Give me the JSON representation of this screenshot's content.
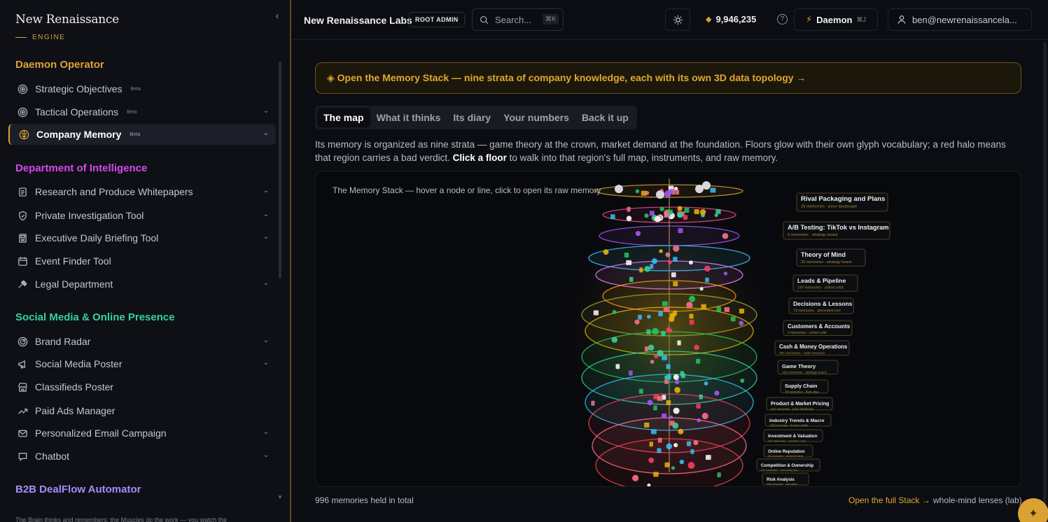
{
  "brand": {
    "name": "New Renaissance",
    "sub": "ENGINE"
  },
  "sidebar": {
    "sections": [
      {
        "title": "Daemon Operator",
        "color": "#e0a035"
      },
      {
        "title": "Department of Intelligence",
        "color": "#d946ef"
      },
      {
        "title": "Social Media & Online Presence",
        "color": "#34d399"
      },
      {
        "title": "B2B DealFlow Automator",
        "color": "#a78bfa"
      }
    ],
    "items": [
      {
        "label": "Strategic Objectives",
        "badge": "Beta",
        "icon": "target-icon"
      },
      {
        "label": "Tactical Operations",
        "badge": "Beta",
        "icon": "target-icon"
      },
      {
        "label": "Company Memory",
        "badge": "Beta",
        "icon": "brain-icon"
      },
      {
        "label": "Research and Produce Whitepapers",
        "icon": "document-icon"
      },
      {
        "label": "Private Investigation Tool",
        "icon": "shield-icon"
      },
      {
        "label": "Executive Daily Briefing Tool",
        "icon": "newspaper-icon"
      },
      {
        "label": "Event Finder Tool",
        "icon": "calendar-icon"
      },
      {
        "label": "Legal Department",
        "icon": "gavel-icon"
      },
      {
        "label": "Brand Radar",
        "icon": "radar-icon"
      },
      {
        "label": "Social Media Poster",
        "icon": "megaphone-icon"
      },
      {
        "label": "Classifieds Poster",
        "icon": "store-icon"
      },
      {
        "label": "Paid Ads Manager",
        "icon": "trending-up-icon"
      },
      {
        "label": "Personalized Email Campaign",
        "icon": "mail-icon"
      },
      {
        "label": "Chatbot",
        "icon": "chat-icon"
      }
    ],
    "footer": "The Brain thinks and remembers; the Muscles do the work — you watch the"
  },
  "header": {
    "org": "New Renaissance Labs",
    "role": "ROOT ADMIN",
    "search_placeholder": "Search...",
    "search_kbd": "⌘K",
    "credits": "9,946,235",
    "daemon_label": "Daemon",
    "daemon_kbd": "⌘J",
    "user_email": "ben@newrenaissancela..."
  },
  "main": {
    "banner": "◈ Open the Memory Stack — nine strata of company knowledge, each with its own 3D data topology →",
    "tabs": [
      "The map",
      "What it thinks",
      "Its diary",
      "Your numbers",
      "Back it up"
    ],
    "desc_a": "Its memory is organized as nine strata — game theory at the crown, market demand at the foundation. Floors glow with their own glyph vocabulary; a red halo means that region carries a bad verdict.",
    "desc_bold": "Click a floor",
    "desc_b": "to walk into that region's full map, instruments, and raw memory.",
    "stack_caption": "The Memory Stack — hover a node or line, click to open its raw memory",
    "total": "996 memories held in total",
    "open_full": "Open the full Stack →",
    "lenses": "whole-mind lenses (lab)"
  },
  "stack_labels": [
    {
      "title": "Rival Packaging and Plans",
      "sub": "25 memories · price landscape"
    },
    {
      "title": "A/B Testing: TikTok vs Instagram",
      "sub": "0 memories · strategy board"
    },
    {
      "title": "Theory of Mind",
      "sub": "32 memories · strategy board"
    },
    {
      "title": "Leads & Pipeline",
      "sub": "147 memories · cohort orbit"
    },
    {
      "title": "Decisions & Lessons",
      "sub": "73 memories · precedent tree"
    },
    {
      "title": "Customers & Accounts",
      "sub": "2 memories · cohort orbit"
    },
    {
      "title": "Cash & Money Operations",
      "sub": "301 memories · cash reservoir"
    },
    {
      "title": "Game Theory",
      "sub": "102 memories · strategy board"
    },
    {
      "title": "Supply Chain",
      "sub": "78 memories · flow atlas"
    },
    {
      "title": "Product & Market Pricing",
      "sub": "510 memories · price landscape"
    },
    {
      "title": "Industry Trends & Macro",
      "sub": "135 memories · horizon shells"
    },
    {
      "title": "Investment & Valuation",
      "sub": "402 memories · valuation cone"
    },
    {
      "title": "Online Reputation",
      "sub": "58 memories · sentiment field"
    },
    {
      "title": "Competition & Ownership",
      "sub": "297 memories · ownership web"
    },
    {
      "title": "Risk Analysis",
      "sub": "308 memories · risk lattice"
    }
  ],
  "colors": {
    "accent": "#e0a035",
    "danger": "#ef4444"
  }
}
